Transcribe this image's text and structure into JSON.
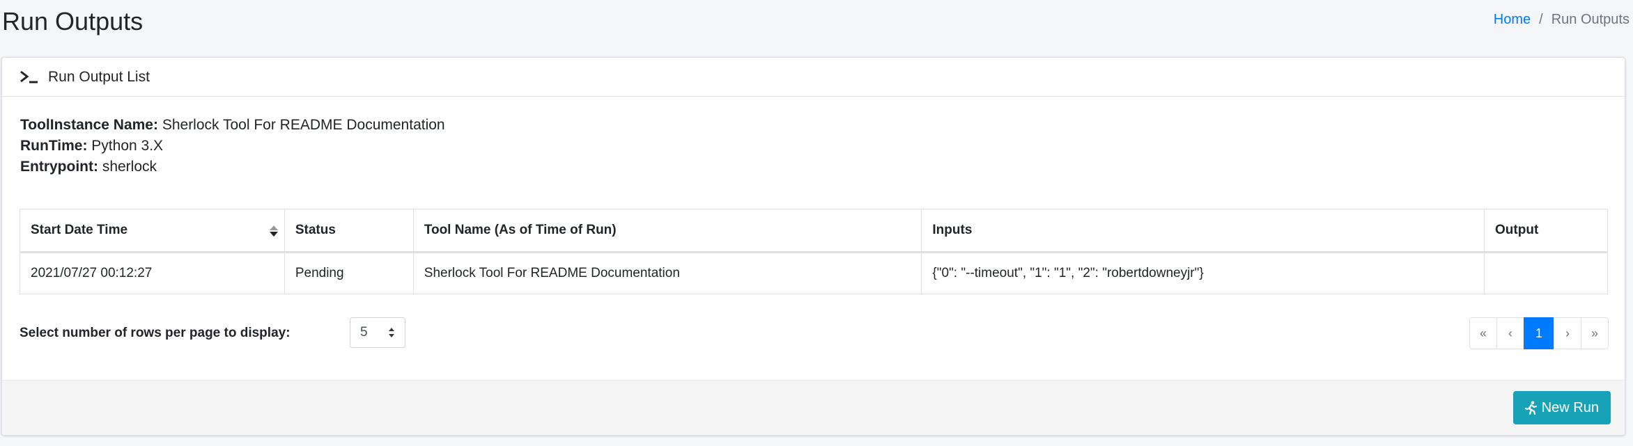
{
  "page": {
    "title": "Run Outputs",
    "breadcrumb": {
      "home": "Home",
      "separator": "/",
      "current": "Run Outputs"
    }
  },
  "card": {
    "header_title": "Run Output List",
    "header_icon": "terminal-icon",
    "meta": [
      {
        "label": "ToolInstance Name:",
        "value": "Sherlock Tool For README Documentation"
      },
      {
        "label": "RunTime:",
        "value": "Python 3.X"
      },
      {
        "label": "Entrypoint:",
        "value": "sherlock"
      }
    ],
    "table": {
      "columns": [
        "Start Date Time",
        "Status",
        "Tool Name (As of Time of Run)",
        "Inputs",
        "Output"
      ],
      "rows": [
        [
          "2021/07/27 00:12:27",
          "Pending",
          "Sherlock Tool For README Documentation",
          "{\"0\": \"--timeout\", \"1\": \"1\", \"2\": \"robertdowneyjr\"}",
          ""
        ]
      ]
    },
    "rows_per_page": {
      "label": "Select number of rows per page to display:",
      "value": "5"
    },
    "pagination": {
      "first": "«",
      "prev": "‹",
      "current": "1",
      "next": "›",
      "last": "»"
    },
    "new_run_label": "New Run",
    "new_run_icon": "running-person-icon"
  },
  "colors": {
    "primary": "#007bff",
    "info": "#17a2b8",
    "background": "#f4f6f9"
  }
}
